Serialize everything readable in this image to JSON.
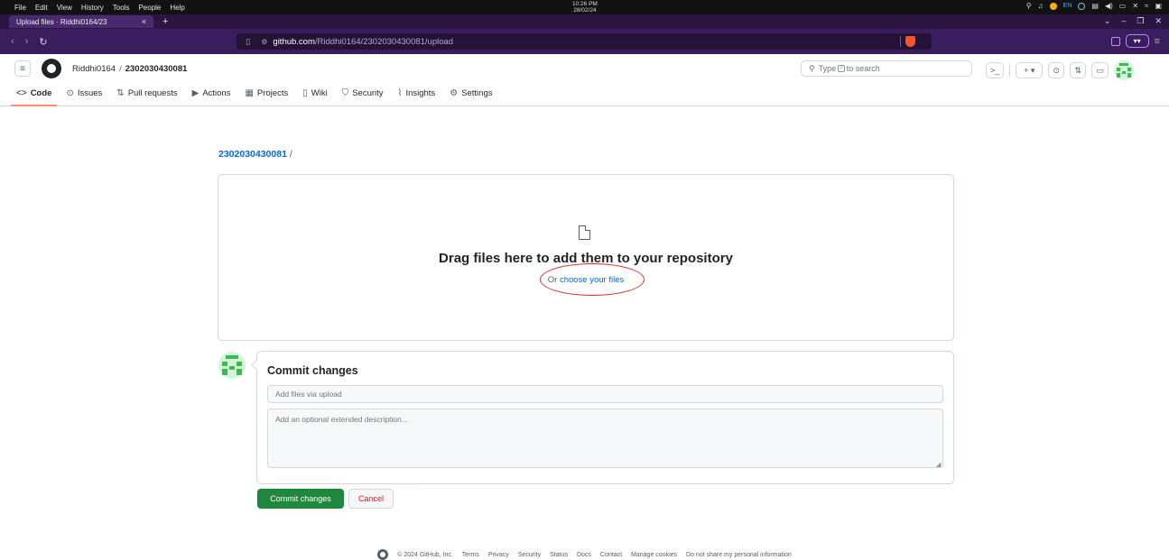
{
  "os": {
    "menu": [
      "File",
      "Edit",
      "View",
      "History",
      "Tools",
      "People",
      "Help"
    ],
    "clock_time": "10:26 PM",
    "clock_date": "28/02/24",
    "lang": "EN"
  },
  "browser": {
    "tab_title": "Upload files · Riddhi0164/23",
    "url_host": "github.com",
    "url_path": "/Riddhi0164/2302030430081/upload"
  },
  "header": {
    "owner": "Riddhi0164",
    "separator": "/",
    "repo": "2302030430081",
    "search_pre": "Type",
    "search_key": "/",
    "search_post": "to search"
  },
  "repo_nav": [
    {
      "icon": "<>",
      "label": "Code"
    },
    {
      "icon": "⊙",
      "label": "Issues"
    },
    {
      "icon": "⇅",
      "label": "Pull requests"
    },
    {
      "icon": "▶",
      "label": "Actions"
    },
    {
      "icon": "▦",
      "label": "Projects"
    },
    {
      "icon": "▯",
      "label": "Wiki"
    },
    {
      "icon": "⛉",
      "label": "Security"
    },
    {
      "icon": "⌇",
      "label": "Insights"
    },
    {
      "icon": "⚙",
      "label": "Settings"
    }
  ],
  "breadcrumb": {
    "repo": "2302030430081",
    "slash": "/"
  },
  "dropzone": {
    "title": "Drag files here to add them to your repository",
    "or": "Or ",
    "choose_link": "choose your files"
  },
  "commit": {
    "title": "Commit changes",
    "summary_placeholder": "Add files via upload",
    "description_placeholder": "Add an optional extended description...",
    "commit_button": "Commit changes",
    "cancel_button": "Cancel"
  },
  "footer": {
    "copyright": "© 2024 GitHub, Inc.",
    "links": [
      "Terms",
      "Privacy",
      "Security",
      "Status",
      "Docs",
      "Contact",
      "Manage cookies",
      "Do not share my personal information"
    ]
  },
  "colors": {
    "accent": "#0969da",
    "commit_green": "#1f883d",
    "annotation_red": "#d32f2f",
    "tab_underline": "#fd8c73"
  }
}
